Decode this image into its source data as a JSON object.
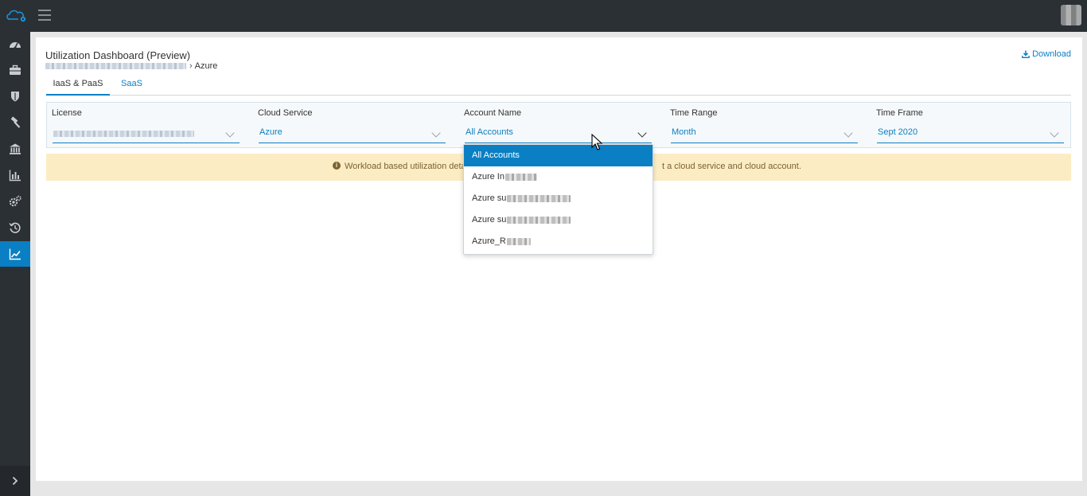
{
  "header": {
    "logo_icon": "cloud-settings-icon",
    "menu_icon": "hamburger-icon",
    "avatar": "user-avatar"
  },
  "sidebar": {
    "items": [
      {
        "icon": "dashboard-gauge-icon",
        "active": false
      },
      {
        "icon": "briefcase-icon",
        "active": false
      },
      {
        "icon": "shield-icon",
        "active": false
      },
      {
        "icon": "hammer-icon",
        "active": false
      },
      {
        "icon": "bank-icon",
        "active": false
      },
      {
        "icon": "bar-chart-icon",
        "active": false
      },
      {
        "icon": "gears-icon",
        "active": false
      },
      {
        "icon": "history-icon",
        "active": false
      },
      {
        "icon": "line-chart-icon",
        "active": true
      }
    ],
    "expand_icon": "chevron-right-icon"
  },
  "page": {
    "title": "Utilization Dashboard (Preview)",
    "breadcrumb": {
      "current": "Azure"
    },
    "download_label": "Download"
  },
  "tabs": [
    {
      "label": "IaaS & PaaS",
      "active": true
    },
    {
      "label": "SaaS",
      "active": false
    }
  ],
  "filters": {
    "license": {
      "label": "License",
      "value": ""
    },
    "cloud_service": {
      "label": "Cloud Service",
      "value": "Azure"
    },
    "account_name": {
      "label": "Account Name",
      "value": "All Accounts"
    },
    "time_range": {
      "label": "Time Range",
      "value": "Month"
    },
    "time_frame": {
      "label": "Time Frame",
      "value": "Sept 2020"
    }
  },
  "alert": {
    "icon": "info-circle-icon",
    "text_start": "Workload based utilization detai",
    "text_end": "t a cloud service and cloud account."
  },
  "account_dropdown": {
    "options": [
      {
        "label": "All Accounts",
        "selected": true
      },
      {
        "label": "Azure In",
        "selected": false
      },
      {
        "label": "Azure su",
        "selected": false
      },
      {
        "label": "Azure su",
        "selected": false
      },
      {
        "label": "Azure_R",
        "selected": false
      }
    ]
  },
  "colors": {
    "accent": "#0a7fc4",
    "sidebar_bg": "#2b3035",
    "alert_bg": "#fcecc4",
    "alert_text": "#7a6233"
  }
}
